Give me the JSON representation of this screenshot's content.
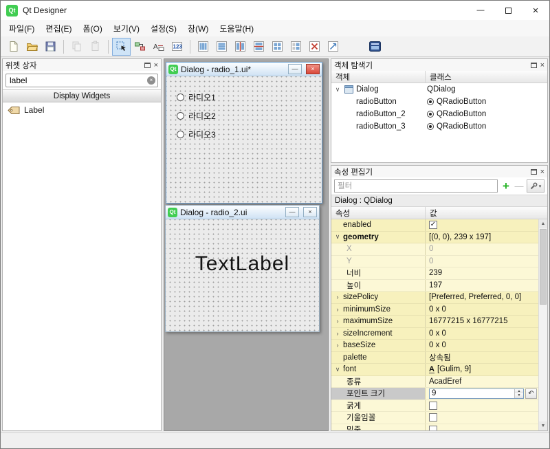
{
  "titlebar": {
    "title": "Qt Designer"
  },
  "menubar": {
    "items": [
      "파일(F)",
      "편집(E)",
      "폼(O)",
      "보기(V)",
      "설정(S)",
      "창(W)",
      "도움말(H)"
    ]
  },
  "icons": {
    "minimize": "—",
    "close": "×",
    "clear": "×",
    "check": "✓",
    "expand_open": "∨",
    "expand_closed": "›",
    "spin_up": "▲",
    "spin_down": "▼",
    "scroll_up": "▲",
    "scroll_down": "▼",
    "reset": "↶",
    "caret_down": "▾",
    "font_preview": "A",
    "tab_order": "123",
    "qt_logo": "Qt"
  },
  "colors": {
    "qt_green": "#41cd52",
    "property_group_bg": "#f7f1bd",
    "property_child_bg": "#fcf8d6",
    "active_close_red": "#d9473a",
    "add_filter_green": "#27b427"
  },
  "widget_box": {
    "title": "위젯 상자",
    "search_value": "label",
    "category": "Display Widgets",
    "item": "Label"
  },
  "mdi": {
    "window1": {
      "title": "Dialog - radio_1.ui*",
      "radios": [
        "라디오1",
        "라디오2",
        "라디오3"
      ]
    },
    "window2": {
      "title": "Dialog - radio_2.ui",
      "text": "TextLabel"
    }
  },
  "object_inspector": {
    "title": "객체 탐색기",
    "columns": {
      "object": "객체",
      "class": "클래스"
    },
    "root": {
      "object": "Dialog",
      "class": "QDialog"
    },
    "children": [
      {
        "object": "radioButton",
        "class": "QRadioButton"
      },
      {
        "object": "radioButton_2",
        "class": "QRadioButton"
      },
      {
        "object": "radioButton_3",
        "class": "QRadioButton"
      }
    ]
  },
  "property_editor": {
    "title": "속성 편집기",
    "filter_placeholder": "필터",
    "object_header": "Dialog : QDialog",
    "columns": {
      "property": "속성",
      "value": "값"
    },
    "rows": {
      "enabled": {
        "name": "enabled"
      },
      "geometry": {
        "name": "geometry",
        "value": "[(0, 0), 239 x 197]"
      },
      "x": {
        "name": "X",
        "value": "0"
      },
      "y": {
        "name": "Y",
        "value": "0"
      },
      "width": {
        "name": "너비",
        "value": "239"
      },
      "height": {
        "name": "높이",
        "value": "197"
      },
      "sizePolicy": {
        "name": "sizePolicy",
        "value": "[Preferred, Preferred, 0, 0]"
      },
      "minimumSize": {
        "name": "minimumSize",
        "value": "0 x 0"
      },
      "maximumSize": {
        "name": "maximumSize",
        "value": "16777215 x 16777215"
      },
      "sizeIncrement": {
        "name": "sizeIncrement",
        "value": "0 x 0"
      },
      "baseSize": {
        "name": "baseSize",
        "value": "0 x 0"
      },
      "palette": {
        "name": "palette",
        "value": "상속됨"
      },
      "font": {
        "name": "font",
        "value": "[Gulim, 9]"
      },
      "family": {
        "name": "종류",
        "value": "AcadEref"
      },
      "pointSize": {
        "name": "포인트 크기",
        "value": "9"
      },
      "bold": {
        "name": "굵게"
      },
      "italic": {
        "name": "기울임꼴"
      },
      "underline": {
        "name": "밑줄"
      }
    }
  }
}
